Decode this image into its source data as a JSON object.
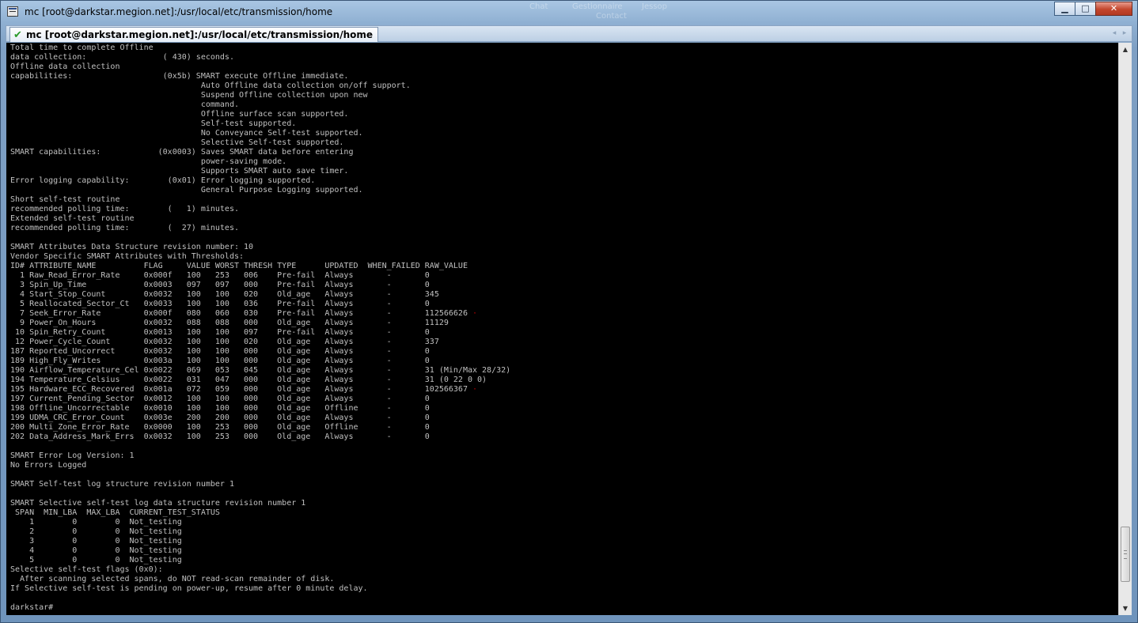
{
  "window": {
    "title": "mc [root@darkstar.megion.net]:/usr/local/etc/transmission/home",
    "ghost_titles": [
      "Chat",
      "Gestionnaire",
      "Contact",
      "Jessop"
    ],
    "buttons": {
      "minimize": "▁",
      "maximize": "□",
      "close": "✕"
    }
  },
  "tab": {
    "label": "mc [root@darkstar.megion.net]:/usr/local/etc/transmission/home",
    "check": "✔",
    "controls": [
      "◂",
      "▸"
    ]
  },
  "terminal": {
    "colors": {
      "foreground": "#c0c0c0",
      "background": "#000000",
      "marker": "#c00000"
    },
    "lines": [
      "Total time to complete Offline",
      "data collection:                ( 430) seconds.",
      "Offline data collection",
      "capabilities:                   (0x5b) SMART execute Offline immediate.",
      "                                        Auto Offline data collection on/off support.",
      "                                        Suspend Offline collection upon new",
      "                                        command.",
      "                                        Offline surface scan supported.",
      "                                        Self-test supported.",
      "                                        No Conveyance Self-test supported.",
      "                                        Selective Self-test supported.",
      "SMART capabilities:            (0x0003) Saves SMART data before entering",
      "                                        power-saving mode.",
      "                                        Supports SMART auto save timer.",
      "Error logging capability:        (0x01) Error logging supported.",
      "                                        General Purpose Logging supported.",
      "Short self-test routine",
      "recommended polling time:        (   1) minutes.",
      "Extended self-test routine",
      "recommended polling time:        (  27) minutes.",
      "",
      "SMART Attributes Data Structure revision number: 10",
      "Vendor Specific SMART Attributes with Thresholds:",
      "ID# ATTRIBUTE_NAME          FLAG     VALUE WORST THRESH TYPE      UPDATED  WHEN_FAILED RAW_VALUE",
      "  1 Raw_Read_Error_Rate     0x000f   100   253   006    Pre-fail  Always       -       0",
      "  3 Spin_Up_Time            0x0003   097   097   000    Pre-fail  Always       -       0",
      "  4 Start_Stop_Count        0x0032   100   100   020    Old_age   Always       -       345",
      "  5 Reallocated_Sector_Ct   0x0033   100   100   036    Pre-fail  Always       -       0",
      "  7 Seek_Error_Rate         0x000f   080   060   030    Pre-fail  Always       -       112566626",
      "  9 Power_On_Hours          0x0032   088   088   000    Old_age   Always       -       11129",
      " 10 Spin_Retry_Count        0x0013   100   100   097    Pre-fail  Always       -       0",
      " 12 Power_Cycle_Count       0x0032   100   100   020    Old_age   Always       -       337",
      "187 Reported_Uncorrect      0x0032   100   100   000    Old_age   Always       -       0",
      "189 High_Fly_Writes         0x003a   100   100   000    Old_age   Always       -       0",
      "190 Airflow_Temperature_Cel 0x0022   069   053   045    Old_age   Always       -       31 (Min/Max 28/32)",
      "194 Temperature_Celsius     0x0022   031   047   000    Old_age   Always       -       31 (0 22 0 0)",
      "195 Hardware_ECC_Recovered  0x001a   072   059   000    Old_age   Always       -       102566367",
      "197 Current_Pending_Sector  0x0012   100   100   000    Old_age   Always       -       0",
      "198 Offline_Uncorrectable   0x0010   100   100   000    Old_age   Offline      -       0",
      "199 UDMA_CRC_Error_Count    0x003e   200   200   000    Old_age   Always       -       0",
      "200 Multi_Zone_Error_Rate   0x0000   100   253   000    Old_age   Offline      -       0",
      "202 Data_Address_Mark_Errs  0x0032   100   253   000    Old_age   Always       -       0",
      "",
      "SMART Error Log Version: 1",
      "No Errors Logged",
      "",
      "SMART Self-test log structure revision number 1",
      "",
      "SMART Selective self-test log data structure revision number 1",
      " SPAN  MIN_LBA  MAX_LBA  CURRENT_TEST_STATUS",
      "    1        0        0  Not_testing",
      "    2        0        0  Not_testing",
      "    3        0        0  Not_testing",
      "    4        0        0  Not_testing",
      "    5        0        0  Not_testing",
      "Selective self-test flags (0x0):",
      "  After scanning selected spans, do NOT read-scan remainder of disk.",
      "If Selective self-test is pending on power-up, resume after 0 minute delay.",
      "",
      "darkstar# "
    ],
    "marked_line_indices": [
      28,
      36
    ],
    "marker_char": "·"
  },
  "scrollbar": {
    "up": "▲",
    "down": "▼",
    "position": 0.96
  }
}
